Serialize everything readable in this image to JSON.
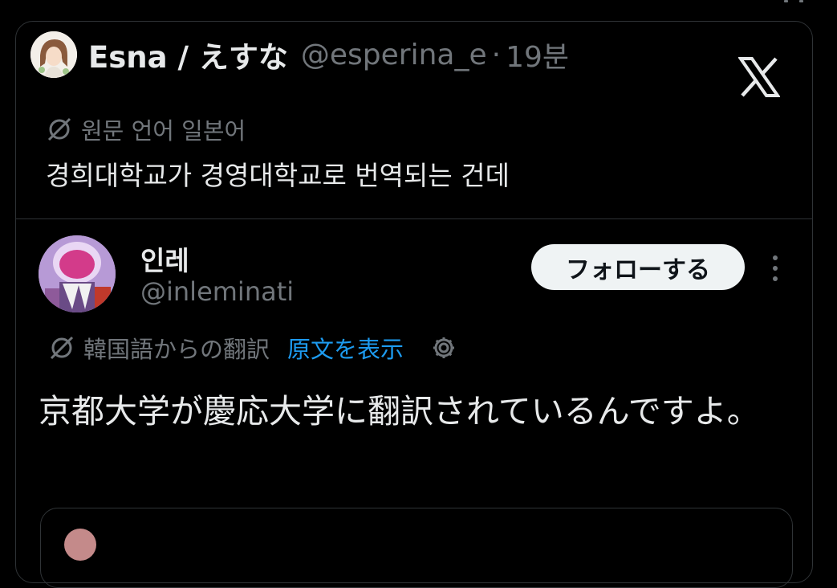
{
  "quoted_tweet": {
    "author_name": "Esna / えすな",
    "handle": "@esperina_e",
    "separator": "·",
    "time": "19분",
    "language_note": "원문 언어 일본어",
    "text": "경희대학교가 경영대학교로 번역되는 건데"
  },
  "main_tweet": {
    "author_name": "인레",
    "handle": "@inleminati",
    "follow_label": "フォローする",
    "translation_label": "韓国語からの翻訳",
    "show_original_label": "原文を表示",
    "text": "京都大学が慶応大学に翻訳されているんですよ。"
  },
  "icons": {
    "logo": "x-logo-icon",
    "translate": "translate-icon",
    "settings": "gear-icon",
    "more": "more-icon"
  },
  "colors": {
    "background": "#000000",
    "text": "#e7e9ea",
    "muted": "#71767b",
    "link": "#1d9bf0",
    "border": "#2f3336"
  }
}
